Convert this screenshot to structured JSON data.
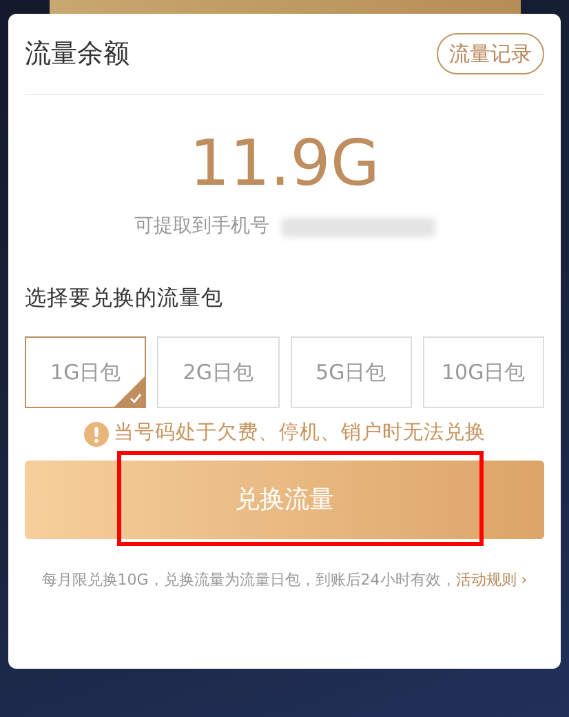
{
  "header": {
    "title": "流量余额",
    "records_button": "流量记录"
  },
  "balance": {
    "amount": "11.9G",
    "phone_label": "可提取到手机号"
  },
  "section_label": "选择要兑换的流量包",
  "packages": [
    {
      "label": "1G日包",
      "selected": true
    },
    {
      "label": "2G日包",
      "selected": false
    },
    {
      "label": "5G日包",
      "selected": false
    },
    {
      "label": "10G日包",
      "selected": false
    }
  ],
  "warning": "当号码处于欠费、停机、销户时无法兑换",
  "exchange_button": {
    "label": "兑换流量",
    "highlighted": true
  },
  "footer": {
    "note": "每月限兑换10G，兑换流量为流量日包，到账后24小时有效，",
    "link": "活动规则 ›"
  }
}
